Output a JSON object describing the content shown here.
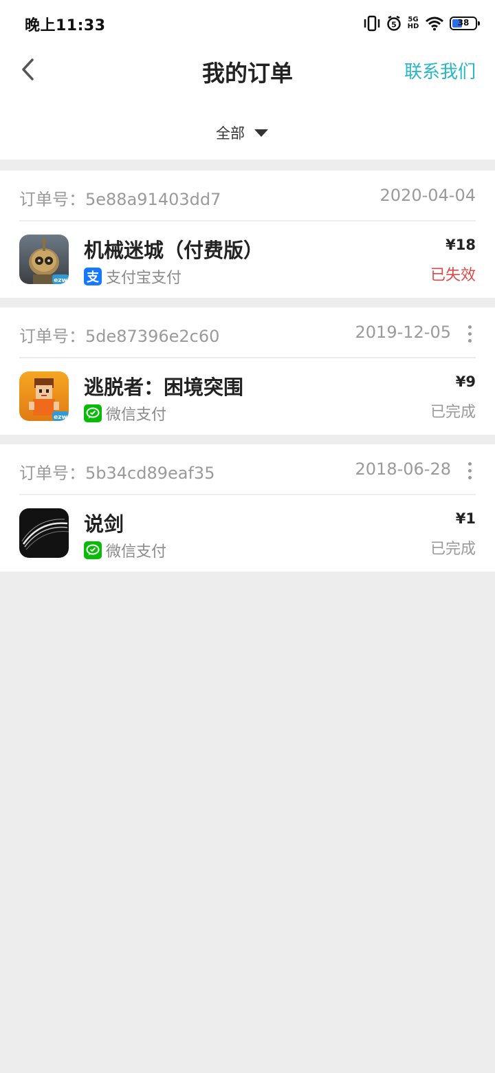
{
  "status_bar": {
    "time": "晚上11:33",
    "network": "5G HD",
    "battery": "38"
  },
  "header": {
    "title": "我的订单",
    "contact": "联系我们"
  },
  "filter": {
    "selected": "全部"
  },
  "orders": [
    {
      "order_no": "订单号：5e88a91403dd7",
      "date": "2020-04-04",
      "app_name": "机械迷城（付费版）",
      "payment": "支付宝支付",
      "payment_icon": "alipay-icon",
      "price": "¥18",
      "status": "已失效",
      "status_color": "#e04848"
    },
    {
      "order_no": "订单号：5de87396e2c60",
      "date": "2019-12-05",
      "app_name": "逃脱者：困境突围",
      "payment": "微信支付",
      "payment_icon": "wechat-pay-icon",
      "price": "¥9",
      "status": "已完成",
      "status_color": "#999999"
    },
    {
      "order_no": "订单号：5b34cd89eaf35",
      "date": "2018-06-28",
      "app_name": "说剑",
      "payment": "微信支付",
      "payment_icon": "wechat-pay-icon",
      "price": "¥1",
      "status": "已完成",
      "status_color": "#999999"
    }
  ],
  "colors": {
    "accent": "#26b8c6",
    "alipay": "#1677ff",
    "wechat": "#09bb07",
    "failed": "#e04848",
    "background": "#ededed"
  }
}
